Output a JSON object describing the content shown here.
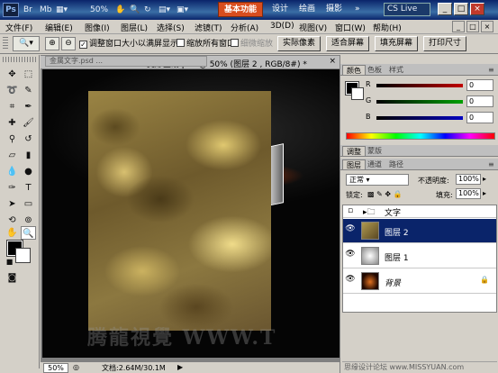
{
  "app": {
    "logo": "Ps",
    "bar_items": [
      "Br",
      "Mb",
      "50%",
      "CS Live"
    ],
    "workspaces": [
      "基本功能",
      "设计",
      "绘画",
      "摄影",
      "»"
    ],
    "active_workspace": "基本功能",
    "window_buttons": [
      "_",
      "□",
      "×"
    ]
  },
  "menu": {
    "items": [
      "文件(F)",
      "编辑(E)",
      "图像(I)",
      "图层(L)",
      "选择(S)",
      "滤镜(T)",
      "分析(A)",
      "3D(D)",
      "视图(V)",
      "窗口(W)",
      "帮助(H)"
    ],
    "controls": [
      "_",
      "□",
      "×"
    ]
  },
  "options": {
    "checkbox_resize": "调整窗口大小以满屏显示",
    "checkbox_all": "缩放所有窗口",
    "checkbox_scrubby": "细微缩放",
    "btn_actual": "实际像素",
    "btn_fit": "适合屏幕",
    "btn_fill": "填充屏幕",
    "btn_print": "打印尺寸"
  },
  "document": {
    "back_tab": "金属文字.psd ...",
    "title": "变形金刚.psd @ 50% (图层 2 , RGB/8#) *",
    "watermark": "腾龍視覺 WWW.T",
    "watermark2": "思缘设计论坛 www.MISSYUAN.com"
  },
  "status": {
    "zoom": "50%",
    "doc_info": "文档:2.64M/30.1M"
  },
  "color_panel": {
    "tabs": [
      "颜色",
      "色板",
      "样式"
    ],
    "channels": [
      {
        "label": "R",
        "value": "0",
        "color": "#c00000"
      },
      {
        "label": "G",
        "value": "0",
        "color": "#00a000"
      },
      {
        "label": "B",
        "value": "0",
        "color": "#0000c0"
      }
    ]
  },
  "adjust_tabs": [
    "调整",
    "蒙版"
  ],
  "layers_panel": {
    "tabs": [
      "图层",
      "通道",
      "路径"
    ],
    "blend_mode": "正常",
    "opacity_label": "不透明度:",
    "opacity": "100%",
    "lock_label": "锁定:",
    "fill_label": "填充:",
    "fill": "100%",
    "layers": [
      {
        "name": "文字",
        "type": "group",
        "visible": false
      },
      {
        "name": "图层 2",
        "type": "layer",
        "visible": true,
        "selected": true
      },
      {
        "name": "图层 1",
        "type": "layer",
        "visible": true,
        "selected": false
      },
      {
        "name": "背景",
        "type": "background",
        "visible": true,
        "selected": false
      }
    ]
  }
}
